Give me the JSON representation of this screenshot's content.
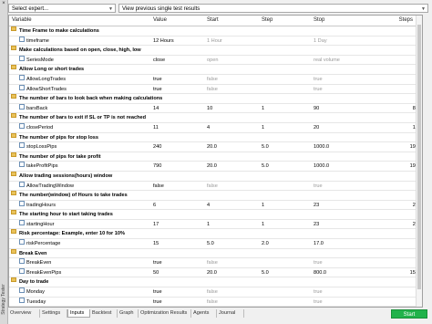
{
  "side_panel_label": "Strategy Tester",
  "expert_select": {
    "value": "Select expert..."
  },
  "view_select": {
    "value": "View previous single test results"
  },
  "columns": [
    "Variable",
    "Value",
    "Start",
    "Step",
    "Stop",
    "Steps"
  ],
  "rows": [
    {
      "kind": "group",
      "label": "Time Frame to make calculations"
    },
    {
      "kind": "param",
      "name": "timeframe",
      "value": "12 Hours",
      "start": "1 Hour",
      "step": "",
      "stop": "1 Day",
      "steps": "8",
      "dim": true
    },
    {
      "kind": "group",
      "label": "Make calculations based on open, close, high, low"
    },
    {
      "kind": "param",
      "name": "SeriesMode",
      "value": "close",
      "start": "open",
      "step": "",
      "stop": "real volume",
      "steps": "",
      "dim": true
    },
    {
      "kind": "group",
      "label": "Allow Long or short trades"
    },
    {
      "kind": "param",
      "name": "AllowLongTrades",
      "value": "true",
      "start": "false",
      "step": "",
      "stop": "true",
      "steps": "",
      "dim": true
    },
    {
      "kind": "param",
      "name": "AllowShortTrades",
      "value": "true",
      "start": "false",
      "step": "",
      "stop": "true",
      "steps": "",
      "dim": true
    },
    {
      "kind": "group",
      "label": "The number of bars to look back when making calculations"
    },
    {
      "kind": "param",
      "name": "barsBack",
      "value": "14",
      "start": "10",
      "step": "1",
      "stop": "90",
      "steps": "81",
      "dim": false
    },
    {
      "kind": "group",
      "label": "The number of bars to exit if SL or TP is not reached"
    },
    {
      "kind": "param",
      "name": "closePeriod",
      "value": "11",
      "start": "4",
      "step": "1",
      "stop": "20",
      "steps": "17",
      "dim": false
    },
    {
      "kind": "group",
      "label": "The number of pips for stop loss"
    },
    {
      "kind": "param",
      "name": "stopLossPips",
      "value": "240",
      "start": "20.0",
      "step": "5.0",
      "stop": "1000.0",
      "steps": "197",
      "dim": false
    },
    {
      "kind": "group",
      "label": "The number of pips for take profit"
    },
    {
      "kind": "param",
      "name": "takeProfitPips",
      "value": "790",
      "start": "20.0",
      "step": "5.0",
      "stop": "1000.0",
      "steps": "197",
      "dim": false
    },
    {
      "kind": "group",
      "label": "Allow trading sessions(hours) window"
    },
    {
      "kind": "param",
      "name": "AllowTradingWindow",
      "value": "false",
      "start": "false",
      "step": "",
      "stop": "true",
      "steps": "2",
      "dim": true
    },
    {
      "kind": "group",
      "label": "The number(window) of Hours to take trades"
    },
    {
      "kind": "param",
      "name": "tradingHours",
      "value": "6",
      "start": "4",
      "step": "1",
      "stop": "23",
      "steps": "20",
      "dim": false
    },
    {
      "kind": "group",
      "label": "The starting hour to start taking trades"
    },
    {
      "kind": "param",
      "name": "startingHour",
      "value": "17",
      "start": "1",
      "step": "1",
      "stop": "23",
      "steps": "23",
      "dim": false
    },
    {
      "kind": "group",
      "label": "Risk percentage: Example, enter 10 for 10%"
    },
    {
      "kind": "param",
      "name": "riskPercentage",
      "value": "15",
      "start": "5.0",
      "step": "2.0",
      "stop": "17.0",
      "steps": "7",
      "dim": false
    },
    {
      "kind": "group",
      "label": "Break Even"
    },
    {
      "kind": "param",
      "name": "BreakEven",
      "value": "true",
      "start": "false",
      "step": "",
      "stop": "true",
      "steps": "",
      "dim": true
    },
    {
      "kind": "param",
      "name": "BreakEvenPips",
      "value": "50",
      "start": "20.0",
      "step": "5.0",
      "stop": "800.0",
      "steps": "157",
      "dim": false
    },
    {
      "kind": "group",
      "label": "Day to trade"
    },
    {
      "kind": "param",
      "name": "Monday",
      "value": "true",
      "start": "false",
      "step": "",
      "stop": "true",
      "steps": "",
      "dim": true
    },
    {
      "kind": "param",
      "name": "Tuesday",
      "value": "true",
      "start": "false",
      "step": "",
      "stop": "true",
      "steps": "",
      "dim": true
    },
    {
      "kind": "param",
      "name": "Wednesday",
      "value": "true",
      "start": "false",
      "step": "",
      "stop": "true",
      "steps": "",
      "dim": true
    },
    {
      "kind": "param",
      "name": "Thursday",
      "value": "false",
      "start": "false",
      "step": "",
      "stop": "true",
      "steps": "",
      "dim": true
    },
    {
      "kind": "param",
      "name": "Friday",
      "value": "false",
      "start": "false",
      "step": "",
      "stop": "true",
      "steps": "",
      "dim": true
    }
  ],
  "tabs": [
    {
      "label": "Overview",
      "active": false
    },
    {
      "label": "Settings",
      "active": false
    },
    {
      "label": "Inputs",
      "active": true
    },
    {
      "label": "Backtest",
      "active": false
    },
    {
      "label": "Graph",
      "active": false
    },
    {
      "label": "Optimization Results",
      "active": false
    },
    {
      "label": "Agents",
      "active": false
    },
    {
      "label": "Journal",
      "active": false
    }
  ],
  "start_button": {
    "label": "Start",
    "color": "#21b24b"
  }
}
